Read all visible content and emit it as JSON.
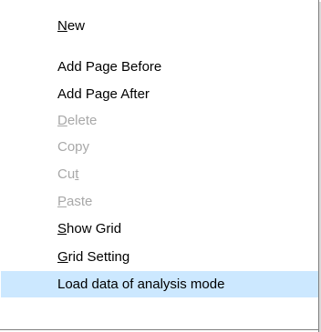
{
  "menu": {
    "items": [
      {
        "label": "New",
        "mnemonic": "N",
        "enabled": true
      },
      {
        "label": "Add Page Before",
        "mnemonic": "",
        "enabled": true
      },
      {
        "label": "Add Page After",
        "mnemonic": "",
        "enabled": true
      },
      {
        "label": "Delete",
        "mnemonic": "D",
        "enabled": false
      },
      {
        "label": "Copy",
        "mnemonic": "",
        "enabled": false
      },
      {
        "label": "Cut",
        "mnemonic": "t",
        "enabled": false
      },
      {
        "label": "Paste",
        "mnemonic": "P",
        "enabled": false
      },
      {
        "label": "Show Grid",
        "mnemonic": "S",
        "enabled": true
      },
      {
        "label": "Grid Setting",
        "mnemonic": "G",
        "enabled": true
      },
      {
        "label": "Load data of analysis mode",
        "mnemonic": "",
        "enabled": true,
        "highlighted": true
      }
    ],
    "colors": {
      "text": "#000000",
      "disabled_text": "#a8a8a8",
      "highlight_bg": "#cce8ff"
    }
  }
}
